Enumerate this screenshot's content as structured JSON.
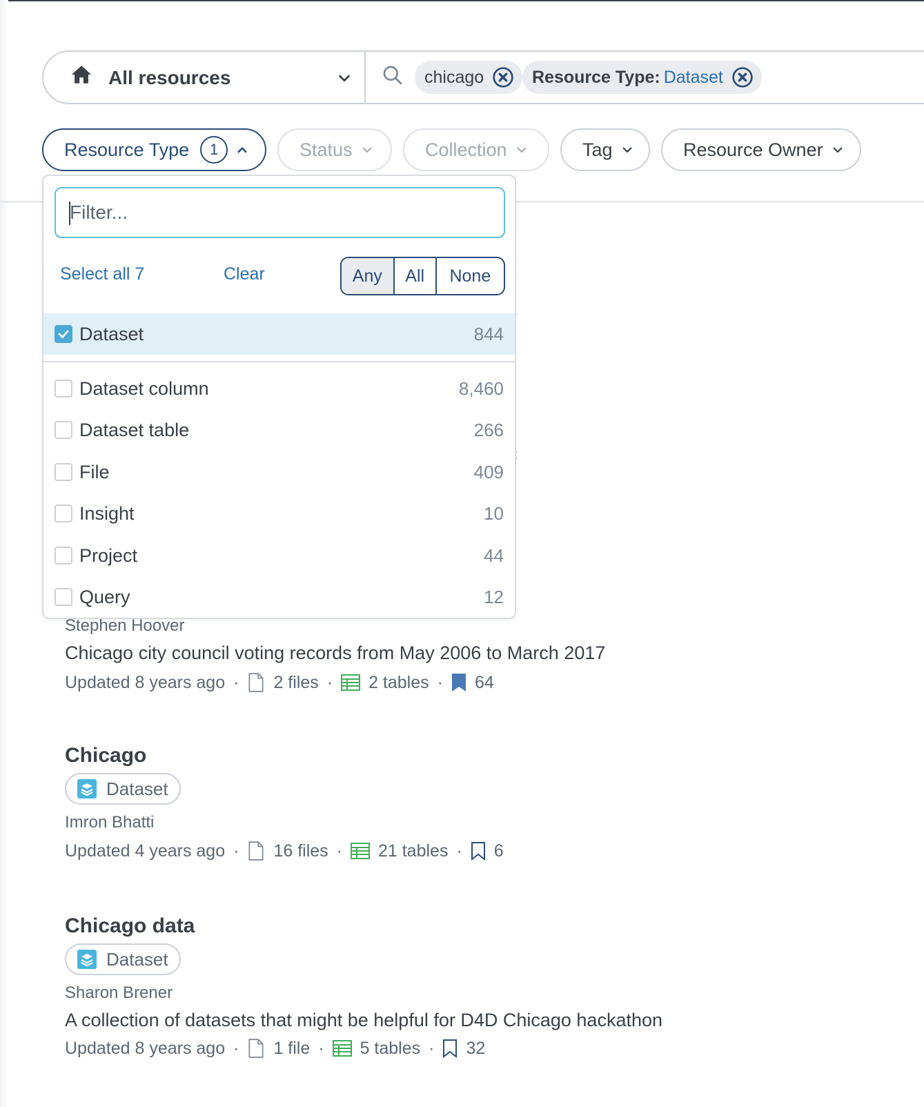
{
  "search": {
    "scope_label": "All resources",
    "chips": [
      {
        "text": "chicago"
      },
      {
        "key": "Resource Type:",
        "value": "Dataset"
      }
    ]
  },
  "filters": {
    "resource_type": {
      "label": "Resource Type",
      "count": "1"
    },
    "status": {
      "label": "Status"
    },
    "collection": {
      "label": "Collection"
    },
    "tag": {
      "label": "Tag"
    },
    "owner": {
      "label": "Resource Owner"
    }
  },
  "dropdown": {
    "placeholder": "Filter...",
    "select_all": "Select all 7",
    "clear": "Clear",
    "modes": {
      "any": "Any",
      "all": "All",
      "none": "None"
    },
    "options": [
      {
        "label": "Dataset",
        "count": "844",
        "checked": true
      },
      {
        "label": "Dataset column",
        "count": "8,460",
        "checked": false
      },
      {
        "label": "Dataset table",
        "count": "266",
        "checked": false
      },
      {
        "label": "File",
        "count": "409",
        "checked": false
      },
      {
        "label": "Insight",
        "count": "10",
        "checked": false
      },
      {
        "label": "Project",
        "count": "44",
        "checked": false
      },
      {
        "label": "Query",
        "count": "12",
        "checked": false
      }
    ]
  },
  "results": [
    {
      "owner": "Stephen Hoover",
      "description": "Chicago city council voting records from May 2006 to March 2017",
      "updated": "Updated 8 years ago",
      "files": "2 files",
      "tables": "2 tables",
      "bookmarks": "64"
    },
    {
      "title": "Chicago",
      "type": "Dataset",
      "owner": "Imron Bhatti",
      "updated": "Updated 4 years ago",
      "files": "16 files",
      "tables": "21 tables",
      "bookmarks": "6"
    },
    {
      "title": "Chicago data",
      "type": "Dataset",
      "owner": "Sharon Brener",
      "description": "A collection of datasets that might be helpful for D4D Chicago hackathon",
      "updated": "Updated 8 years ago",
      "files": "1 file",
      "tables": "5 tables",
      "bookmarks": "32"
    }
  ],
  "colors": {
    "accent": "#2a6fb0",
    "navy": "#2b4c77",
    "selected_bg": "#e1f0f7",
    "table_icon": "#3fae5a",
    "checkbox": "#4aa9d6"
  }
}
